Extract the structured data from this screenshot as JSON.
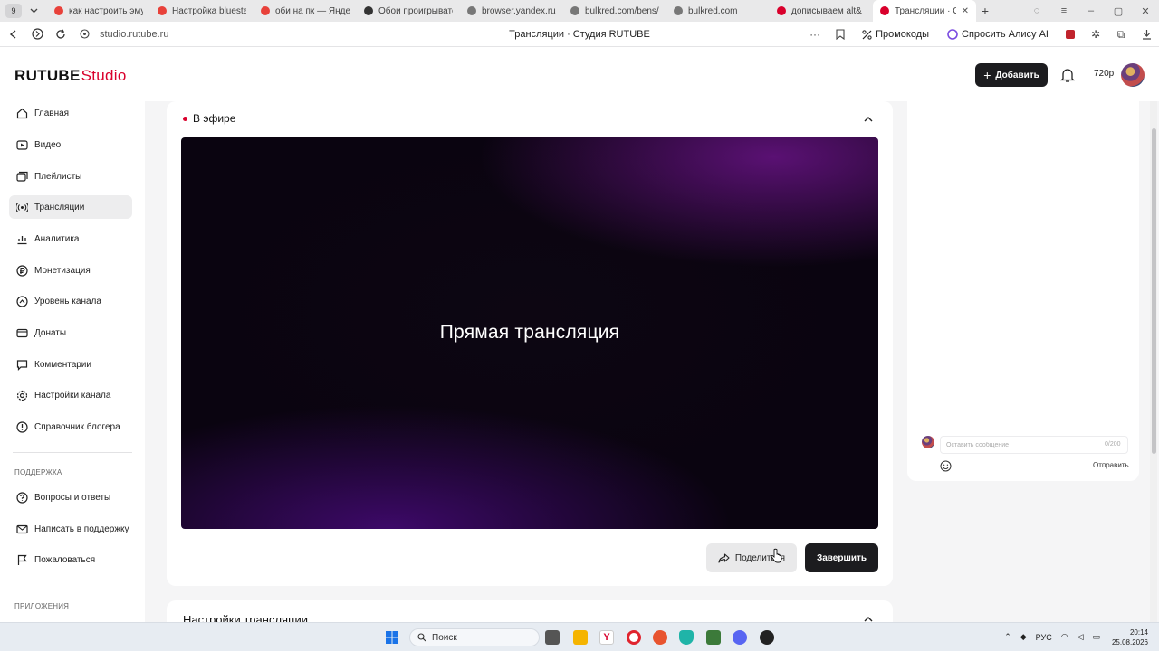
{
  "browser": {
    "tab_count": "9",
    "tabs": [
      {
        "title": "как настроить эмуля",
        "color": "#e8413a"
      },
      {
        "title": "Настройка bluestack",
        "color": "#e8413a"
      },
      {
        "title": "оби на пк — Яндекс:",
        "color": "#e8413a"
      },
      {
        "title": "Обои проигрывател",
        "color": "#333333"
      },
      {
        "title": "browser.yandex.ru/c",
        "color": "#777777"
      },
      {
        "title": "bulkred.com/bens/vi",
        "color": "#777777"
      },
      {
        "title": "bulkred.com",
        "color": "#777777"
      },
      {
        "title": "дописываем alt&",
        "color": "#d9002c"
      },
      {
        "title": "Трансляции · Студ",
        "color": "#d9002c",
        "active": true
      }
    ],
    "url": "studio.rutube.ru",
    "page_title": "Трансляции · Студия RUTUBE",
    "promo_label": "Промокоды",
    "alice_label": "Спросить Алису AI"
  },
  "header": {
    "logo_brand": "RUTUBE",
    "logo_studio": "Studio",
    "add_button": "Добавить",
    "quality": "720p"
  },
  "sidebar": {
    "items": [
      {
        "label": "Главная",
        "icon": "home-icon"
      },
      {
        "label": "Видео",
        "icon": "video-icon"
      },
      {
        "label": "Плейлисты",
        "icon": "playlist-icon"
      },
      {
        "label": "Трансляции",
        "icon": "broadcast-icon",
        "active": true
      },
      {
        "label": "Аналитика",
        "icon": "analytics-icon"
      },
      {
        "label": "Монетизация",
        "icon": "ruble-icon"
      },
      {
        "label": "Уровень канала",
        "icon": "level-icon"
      },
      {
        "label": "Донаты",
        "icon": "donate-icon"
      },
      {
        "label": "Комментарии",
        "icon": "comment-icon"
      },
      {
        "label": "Настройки канала",
        "icon": "gear-icon"
      },
      {
        "label": "Справочник блогера",
        "icon": "book-icon"
      }
    ],
    "support_section": "ПОДДЕРЖКА",
    "support_items": [
      {
        "label": "Вопросы и ответы",
        "icon": "question-icon"
      },
      {
        "label": "Написать в поддержку",
        "icon": "mail-icon"
      },
      {
        "label": "Пожаловаться",
        "icon": "flag-icon"
      }
    ],
    "apps_section": "ПРИЛОЖЕНИЯ"
  },
  "live": {
    "status_label": "В эфире",
    "player_title": "Прямая трансляция",
    "share_button": "Поделиться",
    "finish_button": "Завершить"
  },
  "settings": {
    "title": "Настройки трансляции"
  },
  "chat": {
    "placeholder": "Оставить сообщение",
    "counter": "0/200",
    "send_button": "Отправить"
  },
  "taskbar": {
    "search_label": "Поиск",
    "lang": "РУС",
    "time": "20:14",
    "date": "25.08.2026"
  }
}
